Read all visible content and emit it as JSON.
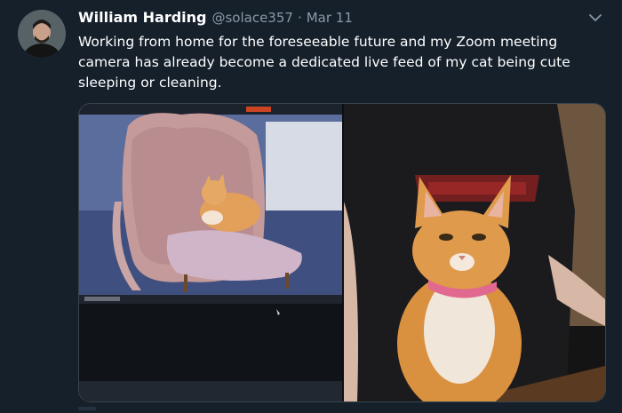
{
  "tweet": {
    "display_name": "William Harding",
    "handle": "@solace357",
    "separator": "·",
    "date": "Mar 11",
    "text": "Working from home for the foreseeable future and my Zoom meeting camera has already become a dedicated live feed of my cat being cute sleeping or cleaning."
  },
  "media": {
    "left_photo": "cat-on-chair-zoom-photo",
    "right_photo": "cat-in-lap-photo"
  },
  "icons": {
    "menu": "chevron-down-icon"
  },
  "colors": {
    "background": "#15202b",
    "text_primary": "#ffffff",
    "text_secondary": "#8899a6",
    "border": "#38444d"
  }
}
